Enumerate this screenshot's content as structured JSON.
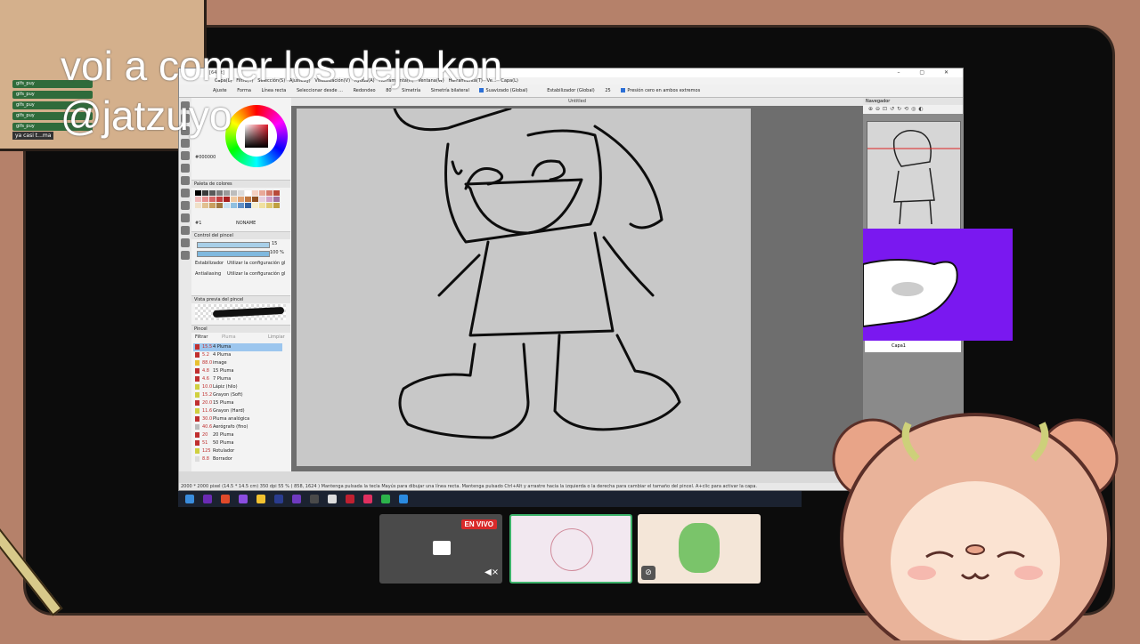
{
  "overlay": {
    "message_line1": "voi a comer los dejo kon",
    "message_line2": "@jatzuyo"
  },
  "chat": {
    "usernames": [
      "gifs_puy",
      "gifs_puy",
      "gifs_puy",
      "gifs_puy",
      "gifs_puy"
    ],
    "last_message": "ya casi t...ma"
  },
  "app": {
    "title": "[64bit]",
    "menu": [
      "Capa(L)",
      "Filtro(T)",
      "Selección(S)",
      "Ajustes(J)",
      "Visualización(V)",
      "Ayuda(A)",
      "Herramienta(H)",
      "Ventana(W)",
      "Herramienta(T)",
      "Ve...",
      "Capa(L)"
    ],
    "toolbar": {
      "adjust_label": "Ajuste",
      "shape_label": "Forma",
      "shape_value": "Línea recta",
      "select_label": "Seleccionar desde ...",
      "rounding_label": "Redondeo",
      "rounding_value": "80",
      "symmetry_label": "Simetría",
      "symmetry_value": "Simetría bilateral",
      "smoothing_label": "Suavizado (Global)",
      "stabilizer_label": "Estabilizador (Global)",
      "stabilizer_value": "25",
      "pressure_label": "Presión cero en ambos extremos"
    },
    "color": {
      "hex": "#000000"
    },
    "palette": {
      "title": "Paleta de colores",
      "index": "#1",
      "name": "NONAME",
      "colors": [
        "#000000",
        "#3a3a3a",
        "#5a5a5a",
        "#7a7a7a",
        "#9a9a9a",
        "#bdbdbd",
        "#dcdcdc",
        "#ffffff",
        "#f5d0c0",
        "#e8a898",
        "#d47a6a",
        "#b84a3a",
        "#f2b8b8",
        "#e89090",
        "#d86868",
        "#c44040",
        "#a82020",
        "#f0c8a0",
        "#e0a070",
        "#c07840",
        "#905020",
        "#e8d0e0",
        "#d0a0c8",
        "#a070a0",
        "#f0e0c8",
        "#e0c090",
        "#c8a060",
        "#a07840",
        "#c8e0f0",
        "#90c0e0",
        "#6090c8",
        "#3060a0",
        "#f8f0d0",
        "#f0e0a0",
        "#e0c870",
        "#c0a040"
      ]
    },
    "brush_control": {
      "title": "Control del pincel",
      "size": "15",
      "opacity": "100 %",
      "stabilizer_label": "Estabilizador",
      "stabilizer_value": "Utilizar la configuración gl",
      "antialias_label": "Antialiasing",
      "antialias_value": "Utilizar la configuración gl"
    },
    "brush_preview": {
      "title": "Vista previa del pincel"
    },
    "brush_panel": {
      "title": "Pincel",
      "filter_label": "Filtrar",
      "filter_placeholder": "Pluma",
      "clear_label": "Limpiar",
      "items": [
        {
          "size": "15.5",
          "name": "4  Pluma",
          "color": "#c03030",
          "selected": true
        },
        {
          "size": "5.2",
          "name": "4  Pluma",
          "color": "#c03030",
          "selected": false
        },
        {
          "size": "88.0",
          "name": "image",
          "color": "#e8c030",
          "selected": false
        },
        {
          "size": "4.8",
          "name": "15  Pluma",
          "color": "#c03030",
          "selected": false
        },
        {
          "size": "4.6",
          "name": "7  Pluma",
          "color": "#c03030",
          "selected": false
        },
        {
          "size": "10.0",
          "name": "Lápiz (hilo)",
          "color": "#d0d040",
          "selected": false
        },
        {
          "size": "15.2",
          "name": "Grayon (Soft)",
          "color": "#d0d040",
          "selected": false
        },
        {
          "size": "20.0",
          "name": "15  Pluma",
          "color": "#c03030",
          "selected": false
        },
        {
          "size": "11.6",
          "name": "Grayon (Hard)",
          "color": "#d0d040",
          "selected": false
        },
        {
          "size": "30.0",
          "name": "Pluma analógica",
          "color": "#c03030",
          "selected": false
        },
        {
          "size": "40.6",
          "name": "Aerógrafo (fino)",
          "color": "#bbbbbb",
          "selected": false
        },
        {
          "size": "20",
          "name": "20  Pluma",
          "color": "#c03030",
          "selected": false
        },
        {
          "size": "51",
          "name": "50  Pluma",
          "color": "#c03030",
          "selected": false
        },
        {
          "size": "125",
          "name": "Rotulador",
          "color": "#d0d040",
          "selected": false
        },
        {
          "size": "8.8",
          "name": "Borrador",
          "color": "#dddddd",
          "selected": false
        }
      ]
    },
    "canvas_tab": "Untitled",
    "navigator_title": "Navegador",
    "layer_name": "Capa1",
    "status": "2000 * 2000 pixel   (14.5 * 14.5 cm)   350 dpi   55 %   ( 858, 1624 )   Mantenga pulsada la tecla Mayús para dibujar una línea recta. Mantenga pulsado Ctrl+Alt y arrastre hacia la izquierda o la derecha para cambiar el tamaño del pincel. A+clic para activar la capa."
  },
  "stream": {
    "live_badge": "EN VIVO"
  },
  "colors": {
    "frame": "#0c0c0c",
    "background": "#b5816a",
    "purple_cam": "#7a18f0",
    "live_red": "#d92a2a",
    "active_thumb_border": "#3db36b"
  }
}
